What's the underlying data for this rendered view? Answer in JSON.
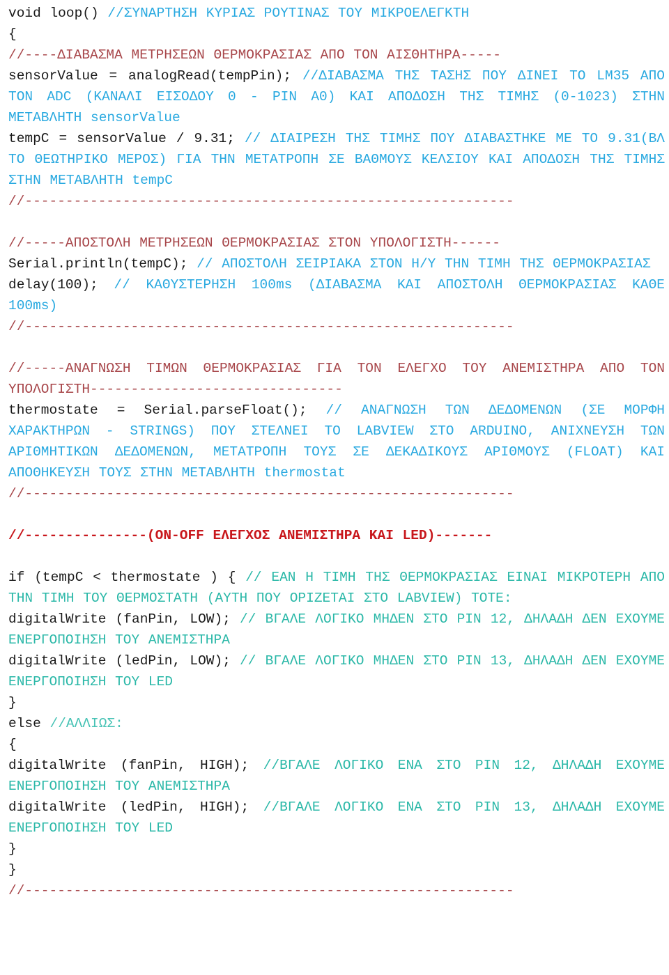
{
  "document": {
    "kind": "source-code-listing",
    "language": "Arduino C",
    "title": "void loop() — Arduino temperature / fan / LED control routine",
    "background_color": "#ffffff",
    "colors": {
      "code_text": "#1a1a1a",
      "comment_cyan": "#29a9e0",
      "comment_teal": "#2bb8a8",
      "comment_teal_pale": "#45c2b4",
      "separator_dark_red": "#a8474b",
      "section_bright_red": "#c8171c"
    }
  },
  "lines": [
    {
      "id": "line-1",
      "segments": [
        {
          "text": "void loop() ",
          "style": "code"
        },
        {
          "text": "//ΣΥΝΑΡΤΗΣΗ ΚΥΡΙΑΣ ΡΟΥΤΙΝΑΣ ΤΟΥ ΜΙΚΡΟΕΛΕΓΚΤΗ",
          "style": "cyan"
        }
      ]
    },
    {
      "id": "line-2",
      "segments": [
        {
          "text": "{",
          "style": "code"
        }
      ]
    },
    {
      "id": "line-3",
      "segments": [
        {
          "text": "//----ΔΙΑΒΑΣΜΑ ΜΕΤΡΗΣΕΩΝ ΘΕΡΜΟΚΡΑΣΙΑΣ ΑΠΟ ΤΟΝ ΑΙΣΘΗΤΗΡΑ-----",
          "style": "darkred"
        }
      ]
    },
    {
      "id": "line-4",
      "wrap": true,
      "segments": [
        {
          "text": "sensorValue = analogRead(tempPin); ",
          "style": "code"
        },
        {
          "text": "//ΔΙΑΒΑΣΜΑ ΤΗΣ ΤΑΣΗΣ ΠΟΥ ΔΙΝΕΙ ΤΟ LM35 ΑΠΟ ΤΟΝ ADC (ΚΑΝΑΛΙ ΕΙΣΟΔΟΥ 0 - PIN A0) ΚΑΙ ΑΠΟΔΟΣΗ ΤΗΣ ΤΙΜΗΣ (0-1023) ΣΤΗΝ ΜΕΤΑΒΛΗΤΗ sensorValue",
          "style": "cyan"
        }
      ]
    },
    {
      "id": "line-5",
      "wrap": true,
      "segments": [
        {
          "text": "tempC = sensorValue / 9.31; ",
          "style": "code"
        },
        {
          "text": "// ΔΙΑΙΡΕΣΗ ΤΗΣ ΤΙΜΗΣ ΠΟΥ ΔΙΑΒΑΣΤΗΚΕ ΜΕ ΤΟ 9.31(ΒΛ ΤΟ ΘΕΩΤΗΡΙΚΟ ΜΕΡΟΣ) ΓΙΑ ΤΗΝ ΜΕΤΑΤΡΟΠΗ ΣΕ ΒΑΘΜΟΥΣ ΚΕΛΣΙΟΥ ΚΑΙ ΑΠΟΔΟΣΗ ΤΗΣ ΤΙΜΗΣ ΣΤΗΝ ΜΕΤΑΒΛΗΤΗ tempC",
          "style": "cyan"
        }
      ]
    },
    {
      "id": "line-6",
      "segments": [
        {
          "text": "//------------------------------------------------------------",
          "style": "darkred"
        }
      ]
    },
    {
      "id": "line-7",
      "blank": true,
      "segments": []
    },
    {
      "id": "line-8",
      "segments": [
        {
          "text": "//-----ΑΠΟΣΤΟΛΗ ΜΕΤΡΗΣΕΩΝ ΘΕΡΜΟΚΡΑΣΙΑΣ ΣΤΟΝ ΥΠΟΛΟΓΙΣΤΗ------",
          "style": "darkred"
        }
      ]
    },
    {
      "id": "line-9",
      "wrap": true,
      "segments": [
        {
          "text": "Serial.println(tempC); ",
          "style": "code"
        },
        {
          "text": "// ΑΠΟΣΤΟΛΗ ΣΕΙΡΙΑΚΑ ΣΤΟΝ Η/Υ ΤΗΝ ΤΙΜΗ ΤΗΣ ΘΕΡΜΟΚΡΑΣΙΑΣ",
          "style": "cyan"
        }
      ]
    },
    {
      "id": "line-10",
      "wrap": true,
      "segments": [
        {
          "text": "delay(100); ",
          "style": "code"
        },
        {
          "text": "// ΚΑΘΥΣΤΕΡΗΣΗ 100ms (ΔΙΑΒΑΣΜΑ ΚΑΙ ΑΠΟΣΤΟΛΗ ΘΕΡΜΟΚΡΑΣΙΑΣ ΚΑΘΕ 100ms)",
          "style": "cyan"
        }
      ]
    },
    {
      "id": "line-11",
      "segments": [
        {
          "text": "//------------------------------------------------------------",
          "style": "darkred"
        }
      ]
    },
    {
      "id": "line-12",
      "blank": true,
      "segments": []
    },
    {
      "id": "line-13",
      "wrap": true,
      "segments": [
        {
          "text": "//-----ΑΝΑΓΝΩΣΗ ΤΙΜΩΝ ΘΕΡΜΟΚΡΑΣΙΑΣ ΓΙΑ ΤΟΝ ΕΛΕΓΧΟ ΤΟΥ ΑΝΕΜΙΣΤΗΡΑ ΑΠΟ ΤΟΝ ΥΠΟΛΟΓΙΣΤΗ-------------------------------",
          "style": "darkred"
        }
      ]
    },
    {
      "id": "line-14",
      "wrap": true,
      "segments": [
        {
          "text": "thermostate = Serial.parseFloat(); ",
          "style": "code"
        },
        {
          "text": "// ΑΝΑΓΝΩΣΗ ΤΩΝ ΔΕΔΟΜΕΝΩΝ (ΣΕ ΜΟΡΦΗ ΧΑΡΑΚΤΗΡΩΝ - STRINGS) ΠΟΥ ΣΤΕΛΝΕΙ ΤΟ LABVIEW ΣΤΟ ARDUINO, ΑΝΙΧΝΕΥΣΗ ΤΩΝ ΑΡΙΘΜΗΤΙΚΩΝ ΔΕΔΟΜΕΝΩΝ, ΜΕΤΑΤΡΟΠΗ ΤΟΥΣ ΣΕ ΔΕΚΑΔΙΚΟΥΣ ΑΡΙΘΜΟΥΣ (FLOAT) ΚΑΙ ΑΠΟΘΗΚΕΥΣΗ ΤΟΥΣ ΣΤΗΝ ΜΕΤΑΒΛΗΤΗ thermostat",
          "style": "cyan"
        }
      ]
    },
    {
      "id": "line-15",
      "segments": [
        {
          "text": "//------------------------------------------------------------",
          "style": "darkred"
        }
      ]
    },
    {
      "id": "line-16",
      "blank": true,
      "segments": []
    },
    {
      "id": "line-17",
      "segments": [
        {
          "text": "//---------------(ON-OFF ΕΛΕΓΧΟΣ ΑΝΕΜΙΣΤΗΡΑ ΚΑΙ LED)-------",
          "style": "brightred"
        }
      ]
    },
    {
      "id": "line-18",
      "blank": true,
      "segments": []
    },
    {
      "id": "line-19",
      "wrap": true,
      "segments": [
        {
          "text": "if (tempC < thermostate ) { ",
          "style": "code"
        },
        {
          "text": "// ΕΑΝ Η ΤΙΜΗ ΤΗΣ ΘΕΡΜΟΚΡΑΣΙΑΣ ΕΙΝΑΙ ΜΙΚΡΟΤΕΡΗ ΑΠΟ ΤΗΝ ΤΙΜΗ ΤΟΥ ΘΕΡΜΟΣΤΑΤΗ (ΑΥΤΗ ΠΟΥ ΟΡΙΖΕΤΑΙ ΣΤΟ LABVIEW) ΤΟΤΕ:",
          "style": "teal"
        }
      ]
    },
    {
      "id": "line-20",
      "wrap": true,
      "segments": [
        {
          "text": "digitalWrite (fanPin, LOW); ",
          "style": "code"
        },
        {
          "text": "// ΒΓΑΛΕ ΛΟΓΙΚΟ ΜΗΔΕΝ ΣΤΟ PIN 12, ΔΗΛΑΔΗ ΔΕΝ ΕΧΟΥΜΕ ΕΝΕΡΓΟΠΟΙΗΣΗ ΤΟΥ ΑΝΕΜΙΣΤΗΡΑ",
          "style": "teal"
        }
      ]
    },
    {
      "id": "line-21",
      "wrap": true,
      "segments": [
        {
          "text": "digitalWrite (ledPin, LOW); ",
          "style": "code"
        },
        {
          "text": "// ΒΓΑΛΕ ΛΟΓΙΚΟ ΜΗΔΕΝ ΣΤΟ PIN 13, ΔΗΛΑΔΗ ΔΕΝ ΕΧΟΥΜΕ ΕΝΕΡΓΟΠΟΙΗΣΗ ΤΟΥ LED",
          "style": "teal"
        }
      ]
    },
    {
      "id": "line-22",
      "segments": [
        {
          "text": "}",
          "style": "code"
        }
      ]
    },
    {
      "id": "line-23",
      "segments": [
        {
          "text": "else ",
          "style": "code"
        },
        {
          "text": "//ΑΛΛΙΩΣ:",
          "style": "teal-pale"
        }
      ]
    },
    {
      "id": "line-24",
      "segments": [
        {
          "text": "{",
          "style": "code"
        }
      ]
    },
    {
      "id": "line-25",
      "wrap": true,
      "segments": [
        {
          "text": "digitalWrite (fanPin, HIGH); ",
          "style": "code"
        },
        {
          "text": "//ΒΓΑΛΕ ΛΟΓΙΚΟ ΕΝΑ ΣΤΟ PIN 12, ΔΗΛΑΔΗ  ΕΧΟΥΜΕ ΕΝΕΡΓΟΠΟΙΗΣΗ ΤΟΥ ΑΝΕΜΙΣΤΗΡΑ",
          "style": "teal"
        }
      ]
    },
    {
      "id": "line-26",
      "wrap": true,
      "segments": [
        {
          "text": "digitalWrite (ledPin, HIGH); ",
          "style": "code"
        },
        {
          "text": "//ΒΓΑΛΕ ΛΟΓΙΚΟ ΕΝΑ ΣΤΟ PIN 13, ΔΗΛΑΔΗ  ΕΧΟΥΜΕ ΕΝΕΡΓΟΠΟΙΗΣΗ ΤΟΥ LED",
          "style": "teal"
        }
      ]
    },
    {
      "id": "line-27",
      "segments": [
        {
          "text": "}",
          "style": "code"
        }
      ]
    },
    {
      "id": "line-28",
      "segments": [
        {
          "text": "}",
          "style": "code"
        }
      ]
    },
    {
      "id": "line-29",
      "segments": [
        {
          "text": "//------------------------------------------------------------",
          "style": "darkred"
        }
      ]
    }
  ]
}
